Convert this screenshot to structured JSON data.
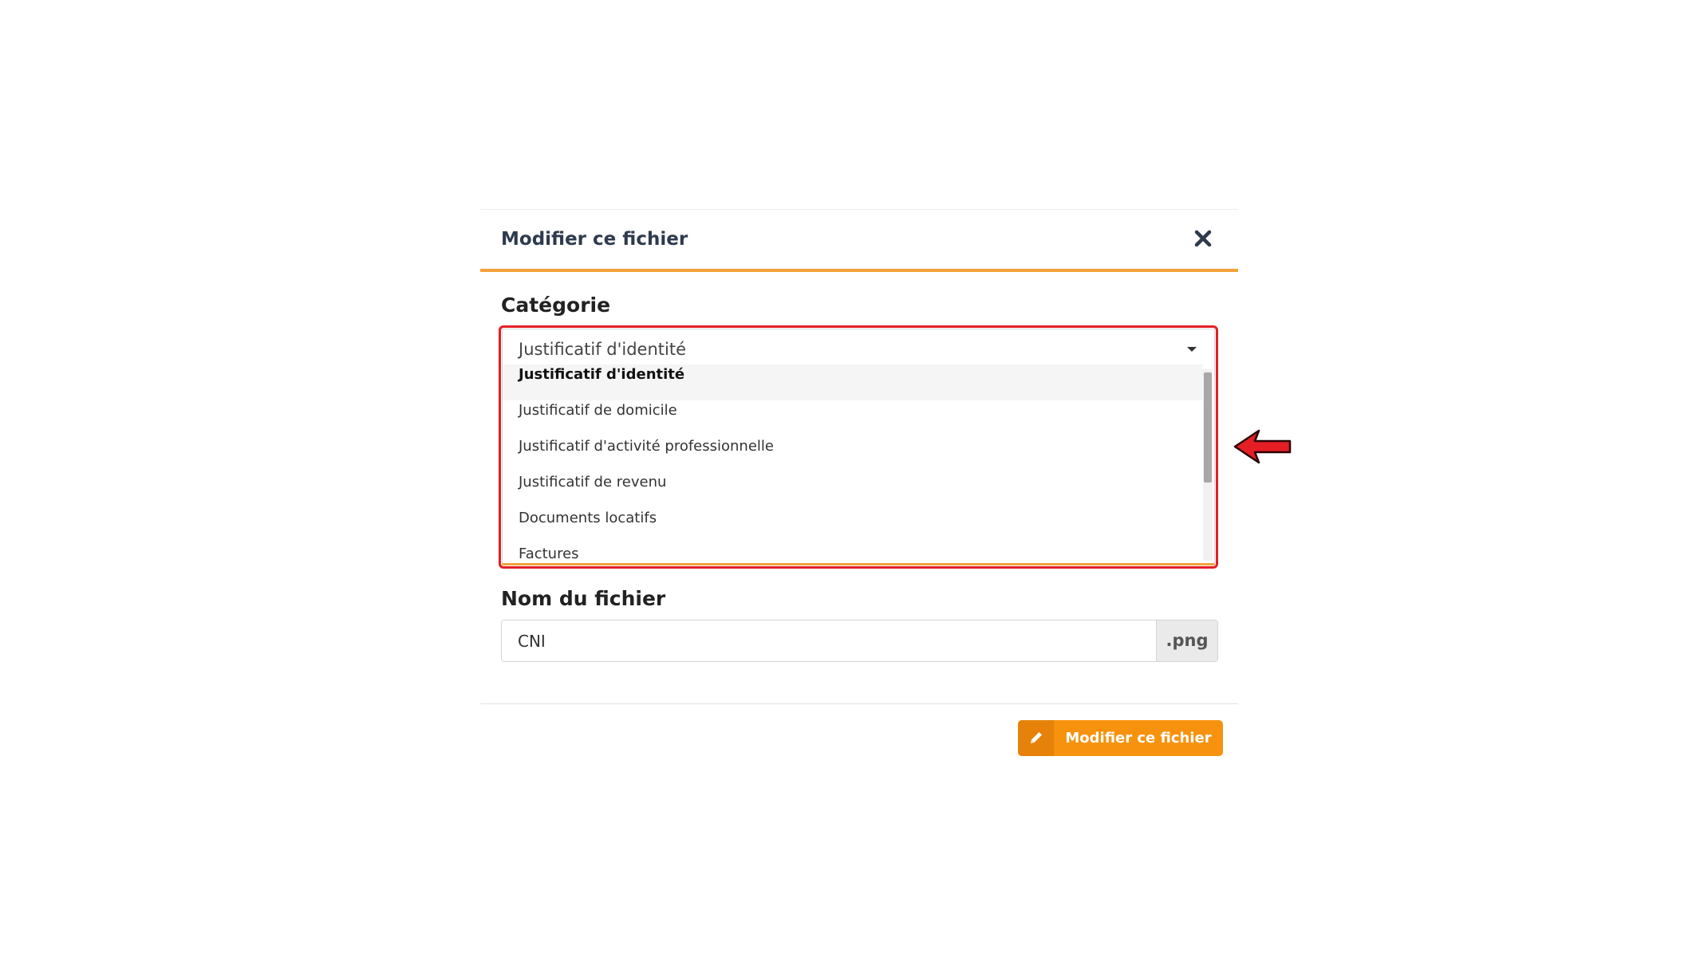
{
  "modal": {
    "title": "Modifier ce fichier",
    "close_icon": "close-icon"
  },
  "category": {
    "label": "Catégorie",
    "selected_value": "Justificatif d'identité",
    "options": [
      "Justificatif d'identité",
      "Justificatif de domicile",
      "Justificatif d'activité professionnelle",
      "Justificatif de revenu",
      "Documents locatifs",
      "Factures"
    ],
    "selected_index": 0
  },
  "filename": {
    "label": "Nom du fichier",
    "value": "CNI",
    "extension": ".png"
  },
  "submit": {
    "label": "Modifier ce fichier",
    "icon": "pencil-icon"
  },
  "colors": {
    "accent": "#f7920e",
    "header_border": "#f5a23a",
    "highlight": "#e51e25"
  }
}
